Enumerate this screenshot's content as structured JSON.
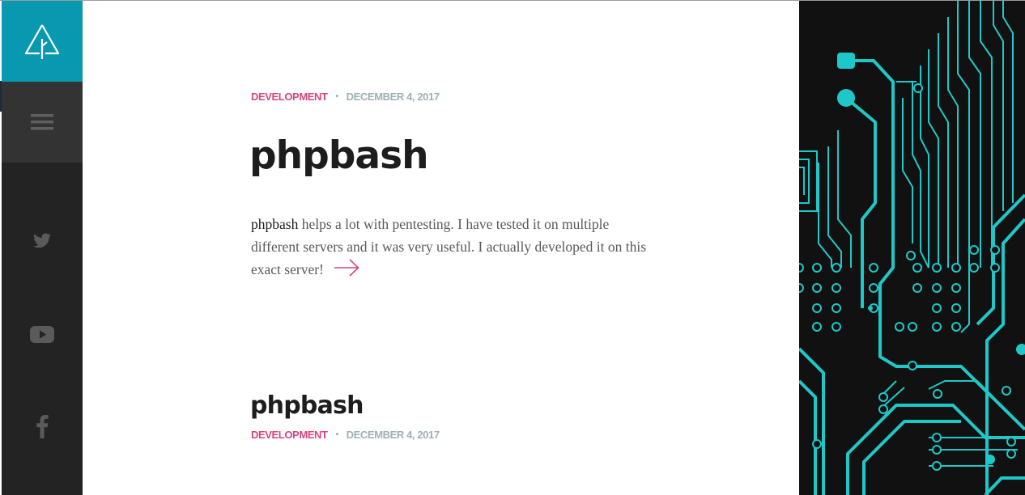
{
  "sidebar": {
    "logo_icon": "tree-icon",
    "menu_icon": "hamburger-menu-icon",
    "social": [
      {
        "icon": "twitter-icon"
      },
      {
        "icon": "youtube-icon"
      },
      {
        "icon": "facebook-icon"
      }
    ]
  },
  "post": {
    "category": "DEVELOPMENT",
    "separator": "•",
    "date": "DECEMBER 4, 2017",
    "title": "phpbash",
    "excerpt_lead": "phpbash",
    "excerpt_rest": " helps a lot with pentesting. I have tested it on multiple different servers and it was very useful. I actually developed it on this exact server!",
    "readmore_icon": "arrow-right-icon"
  },
  "recent": {
    "title": "phpbash",
    "category": "DEVELOPMENT",
    "separator": "•",
    "date": "DECEMBER 4, 2017"
  },
  "colors": {
    "accent_teal": "#0899b1",
    "category_pink": "#d6467f",
    "circuit_cyan": "#1ec8c8",
    "sidebar_dark": "#232323"
  }
}
